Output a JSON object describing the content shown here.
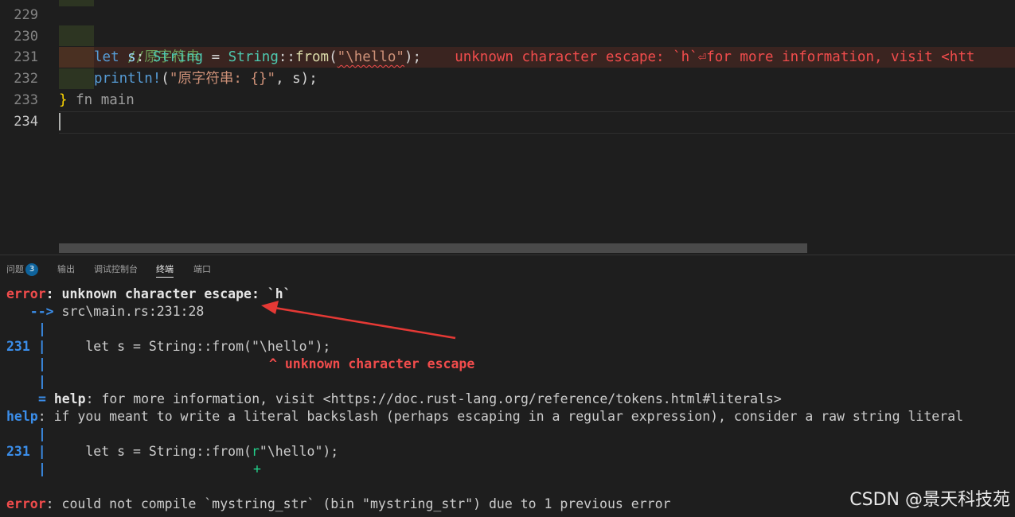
{
  "editor": {
    "line_numbers": [
      "229",
      "230",
      "231",
      "232",
      "233",
      "234"
    ],
    "comment": "//原字符串",
    "line231": {
      "kw": "let",
      "var": "s",
      "colon": ":",
      "type": "String",
      "eq": "=",
      "type2": "String",
      "sep": "::",
      "fn": "from",
      "open": "(",
      "str": "\"\\hello\"",
      "close": ");",
      "inline_error": "unknown character escape: `h`⏎for more information, visit <htt"
    },
    "line232": {
      "macro": "println!",
      "open": "(",
      "str": "\"原字符串: {}\"",
      "rest": ", s);"
    },
    "line233": {
      "brace": "}",
      "hint": "fn main"
    }
  },
  "panel": {
    "tabs": [
      {
        "label": "问题",
        "badge": "3"
      },
      {
        "label": "输出"
      },
      {
        "label": "调试控制台"
      },
      {
        "label": "终端"
      },
      {
        "label": "端口"
      }
    ],
    "terminal": {
      "l1_err": "error",
      "l1_msg": ": unknown character escape: `h`",
      "l2_arrow": "   -->",
      "l2_loc": " src\\main.rs:231:28",
      "pipe": "|",
      "l4_num": "231",
      "l4_code": "     let s = String::from(\"\\hello\");",
      "l5_caret": "^ unknown character escape",
      "l7_eq": "=",
      "l7_help": "help",
      "l7_msg": ": for more information, visit <https://doc.rust-lang.org/reference/tokens.html#literals>",
      "l8_help": "help",
      "l8_msg": ": if you meant to write a literal backslash (perhaps escaping in a regular expression), consider a raw string literal",
      "l10_num": "231",
      "l10_code_a": "     let s = String::from(",
      "l10_r": "r",
      "l10_code_b": "\"\\hello\");",
      "l11_plus": "+",
      "l13_err": "error",
      "l13_msg": ": could not compile `mystring_str` (bin \"mystring_str\") due to 1 previous error"
    }
  },
  "watermark": "CSDN @景天科技苑",
  "colors": {
    "error": "#f14c4c",
    "accent_blue": "#3b8eea",
    "annotation_arrow": "#e53935"
  }
}
